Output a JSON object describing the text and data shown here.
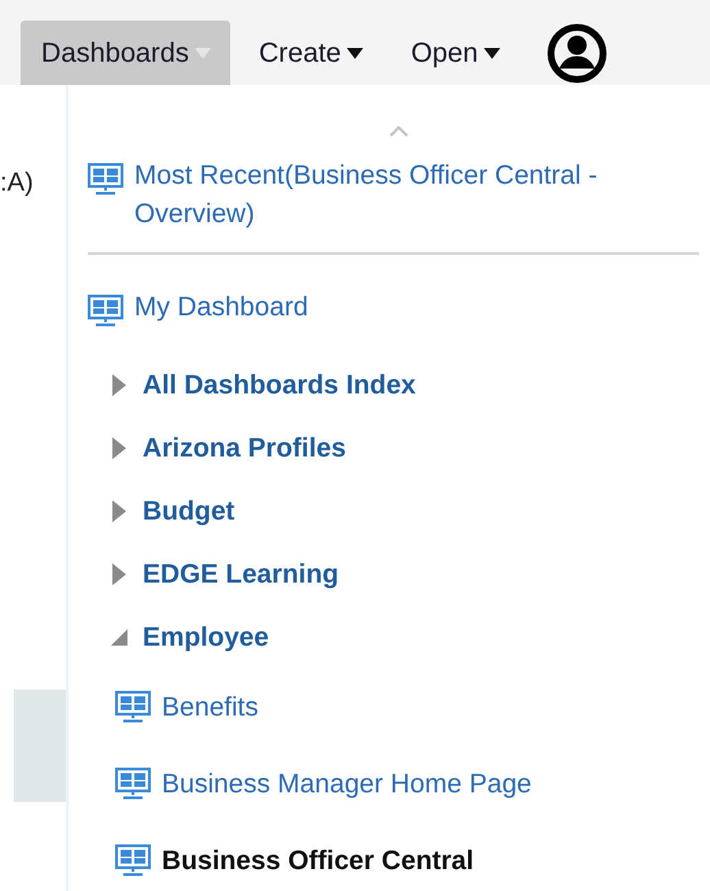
{
  "menubar": [
    {
      "label": "Dashboards",
      "selected": true
    },
    {
      "label": "Create",
      "selected": false
    },
    {
      "label": "Open",
      "selected": false
    }
  ],
  "background": {
    "text": ":A)"
  },
  "menu": {
    "recent": {
      "label": "Most Recent(Business Officer Central - Overview)"
    },
    "items": [
      {
        "kind": "dashboard",
        "label": "My Dashboard",
        "selected": false
      },
      {
        "kind": "folder",
        "label": "All Dashboards Index",
        "expanded": false
      },
      {
        "kind": "folder",
        "label": "Arizona Profiles",
        "expanded": false
      },
      {
        "kind": "folder",
        "label": "Budget",
        "expanded": false
      },
      {
        "kind": "folder",
        "label": "EDGE Learning",
        "expanded": false
      },
      {
        "kind": "folder",
        "label": "Employee",
        "expanded": true,
        "children": [
          {
            "kind": "dashboard",
            "label": "Benefits",
            "selected": false
          },
          {
            "kind": "dashboard",
            "label": "Business Manager Home Page",
            "selected": false
          },
          {
            "kind": "dashboard",
            "label": "Business Officer Central",
            "selected": true
          }
        ]
      }
    ]
  }
}
